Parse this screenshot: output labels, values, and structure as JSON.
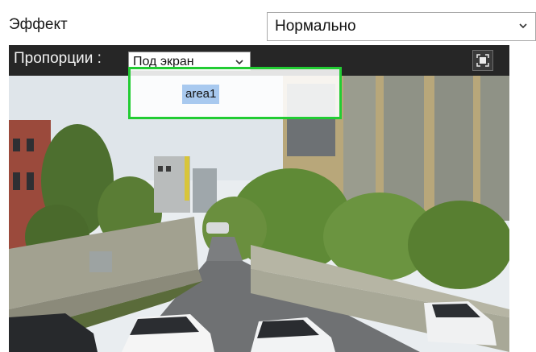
{
  "effect": {
    "label": "Эффект",
    "selected": "Нормально"
  },
  "video": {
    "aspect_label": "Пропорции :",
    "aspect_selected": "Под экран",
    "roi_label": "area1"
  },
  "icons": {
    "effect_dropdown": "chevron-down-icon",
    "aspect_dropdown": "chevron-down-icon",
    "fullscreen": "fullscreen-icon"
  },
  "colors": {
    "roi_border": "#22cc33",
    "roi_label_bg": "#a8c9ef",
    "toolbar_bg": "#262626"
  }
}
